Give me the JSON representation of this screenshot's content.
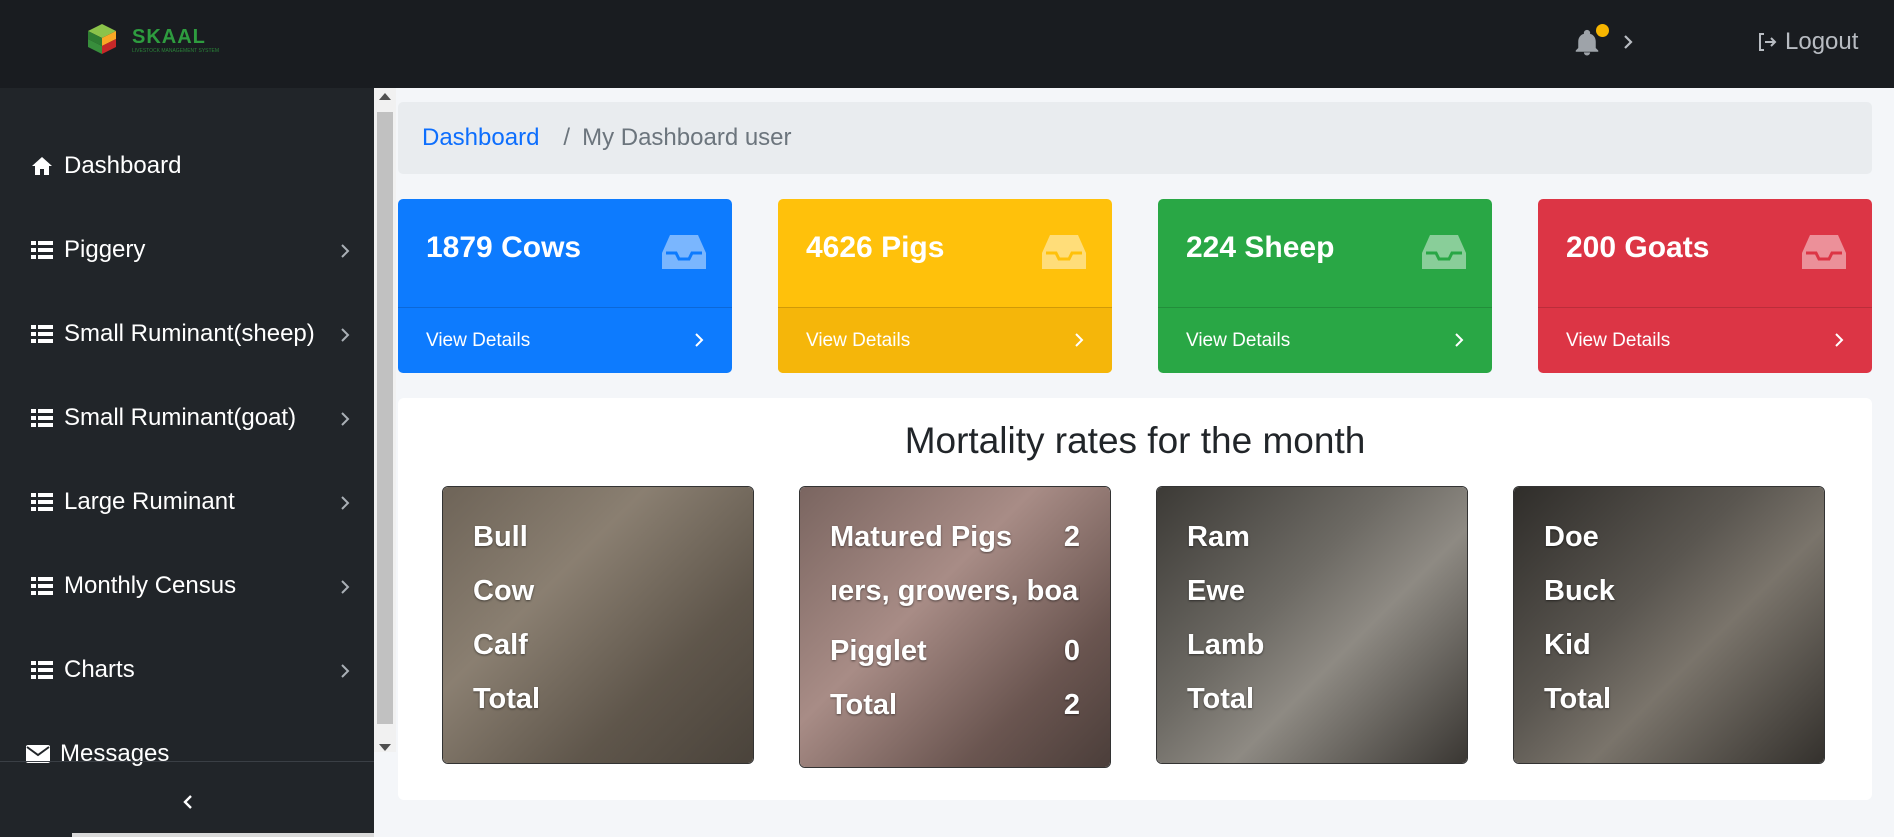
{
  "app": {
    "logo_title": "SKAAL",
    "logo_subtitle": "LIVESTOCK MANAGEMENT SYSTEM"
  },
  "topbar": {
    "logout_label": "Logout"
  },
  "sidebar": {
    "items": [
      {
        "label": "Dashboard",
        "icon": "home-icon",
        "has_submenu": false
      },
      {
        "label": "Piggery",
        "icon": "list-icon",
        "has_submenu": true
      },
      {
        "label": "Small Ruminant(sheep)",
        "icon": "list-icon",
        "has_submenu": true
      },
      {
        "label": "Small Ruminant(goat)",
        "icon": "list-icon",
        "has_submenu": true
      },
      {
        "label": "Large Ruminant",
        "icon": "list-icon",
        "has_submenu": true
      },
      {
        "label": "Monthly Census",
        "icon": "list-icon",
        "has_submenu": true
      },
      {
        "label": "Charts",
        "icon": "list-icon",
        "has_submenu": true
      },
      {
        "label": "Messages",
        "icon": "envelope-icon",
        "has_submenu": false
      }
    ]
  },
  "breadcrumb": {
    "link": "Dashboard",
    "separator": "/",
    "current": "My Dashboard user"
  },
  "cards": [
    {
      "count": "1879 Cows",
      "footer": "View Details",
      "color": "#0d7bfe"
    },
    {
      "count": "4626 Pigs",
      "footer": "View Details",
      "color": "#ffc10b"
    },
    {
      "count": "224 Sheep",
      "footer": "View Details",
      "color": "#29a745"
    },
    {
      "count": "200 Goats",
      "footer": "View Details",
      "color": "#dc3545"
    }
  ],
  "mortality": {
    "title": "Mortality rates for the month",
    "cards": [
      {
        "rows": [
          {
            "label": "Bull",
            "value": ""
          },
          {
            "label": "Cow",
            "value": ""
          },
          {
            "label": "Calf",
            "value": ""
          },
          {
            "label": "Total",
            "value": ""
          }
        ]
      },
      {
        "rows": [
          {
            "label": "Matured Pigs",
            "value": "2"
          },
          {
            "label": "ıers, growers, boar",
            "value": ""
          },
          {
            "label": "Pigglet",
            "value": "0"
          },
          {
            "label": "Total",
            "value": "2"
          }
        ]
      },
      {
        "rows": [
          {
            "label": "Ram",
            "value": ""
          },
          {
            "label": "Ewe",
            "value": ""
          },
          {
            "label": "Lamb",
            "value": ""
          },
          {
            "label": "Total",
            "value": ""
          }
        ]
      },
      {
        "rows": [
          {
            "label": "Doe",
            "value": ""
          },
          {
            "label": "Buck",
            "value": ""
          },
          {
            "label": "Kid",
            "value": ""
          },
          {
            "label": "Total",
            "value": ""
          }
        ]
      }
    ]
  }
}
